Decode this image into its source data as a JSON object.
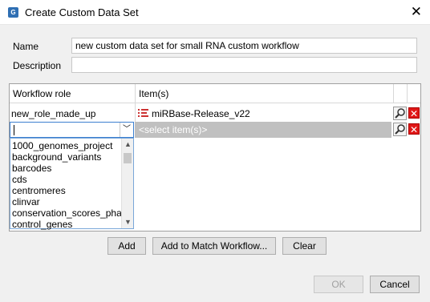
{
  "window": {
    "title": "Create Custom Data Set",
    "app_icon_text": "G"
  },
  "form": {
    "name_label": "Name",
    "name_value": "new custom data set for small RNA custom workflow",
    "description_label": "Description",
    "description_value": ""
  },
  "table": {
    "columns": [
      "Workflow role",
      "Item(s)"
    ],
    "rows": [
      {
        "role": "new_role_made_up",
        "item": "miRBase-Release_v22"
      }
    ],
    "new_row": {
      "role_value": "",
      "item_placeholder": "<select item(s)>"
    }
  },
  "dropdown": {
    "options": [
      "1000_genomes_project",
      "background_variants",
      "barcodes",
      "cds",
      "centromeres",
      "clinvar",
      "conservation_scores_phasto",
      "control_genes"
    ]
  },
  "buttons": {
    "add": "Add",
    "add_to_match": "Add to Match Workflow...",
    "clear": "Clear",
    "ok": "OK",
    "cancel": "Cancel"
  },
  "colors": {
    "accent": "#3c7fd0",
    "delete": "#e01818",
    "selected_row": "#c0c0c0"
  }
}
